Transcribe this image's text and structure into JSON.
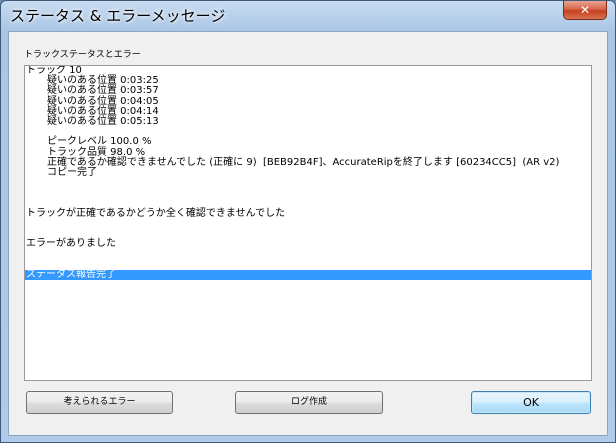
{
  "window": {
    "title": "ステータス & エラーメッセージ",
    "close_glyph": "✕"
  },
  "section_label": "トラックステータスとエラー",
  "log_lines": [
    {
      "text": "トラック 10",
      "indent": false,
      "selected": false
    },
    {
      "text": "疑いのある位置 0:03:25",
      "indent": true,
      "selected": false
    },
    {
      "text": "疑いのある位置 0:03:57",
      "indent": true,
      "selected": false
    },
    {
      "text": "疑いのある位置 0:04:05",
      "indent": true,
      "selected": false
    },
    {
      "text": "疑いのある位置 0:04:14",
      "indent": true,
      "selected": false
    },
    {
      "text": "疑いのある位置 0:05:13",
      "indent": true,
      "selected": false
    },
    {
      "text": "",
      "indent": false,
      "selected": false
    },
    {
      "text": "ピークレベル 100.0 %",
      "indent": true,
      "selected": false
    },
    {
      "text": "トラック品質 98.0 %",
      "indent": true,
      "selected": false
    },
    {
      "text": "正確であるか確認できませんでした (正確に 9)  [BEB92B4F]、AccurateRipを終了します [60234CC5]  (AR v2)",
      "indent": true,
      "selected": false
    },
    {
      "text": "コピー完了",
      "indent": true,
      "selected": false
    },
    {
      "text": "",
      "indent": false,
      "selected": false
    },
    {
      "text": "",
      "indent": false,
      "selected": false
    },
    {
      "text": "",
      "indent": false,
      "selected": false
    },
    {
      "text": "トラックが正確であるかどうか全く確認できませんでした",
      "indent": false,
      "selected": false
    },
    {
      "text": "",
      "indent": false,
      "selected": false
    },
    {
      "text": "",
      "indent": false,
      "selected": false
    },
    {
      "text": "エラーがありました",
      "indent": false,
      "selected": false
    },
    {
      "text": "",
      "indent": false,
      "selected": false
    },
    {
      "text": "",
      "indent": false,
      "selected": false
    },
    {
      "text": "ステータス報告完了",
      "indent": false,
      "selected": true
    }
  ],
  "buttons": {
    "possible_errors": "考えられるエラー",
    "create_log": "ログ作成",
    "ok": "OK"
  },
  "colors": {
    "selection": "#3399ff",
    "close_button": "#c4401f"
  }
}
